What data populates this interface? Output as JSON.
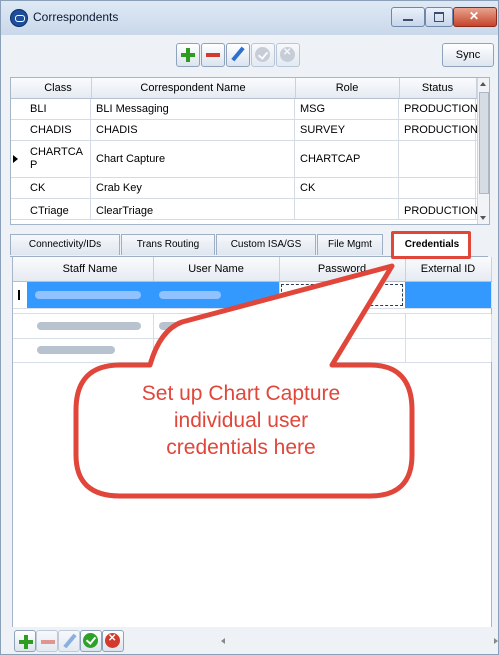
{
  "window": {
    "title": "Correspondents"
  },
  "toolbar": {
    "sync_label": "Sync"
  },
  "correspondents": {
    "columns": [
      "Class",
      "Correspondent Name",
      "Role",
      "Status"
    ],
    "rows": [
      {
        "class": "BLI",
        "name": "BLI Messaging",
        "role": "MSG",
        "status": "PRODUCTION"
      },
      {
        "class": "CHADIS",
        "name": "CHADIS",
        "role": "SURVEY",
        "status": "PRODUCTION"
      },
      {
        "class": "CHARTCA P",
        "name": "Chart Capture",
        "role": "CHARTCAP",
        "status": ""
      },
      {
        "class": "CK",
        "name": "Crab Key",
        "role": "CK",
        "status": ""
      },
      {
        "class": "CTriage",
        "name": "ClearTriage",
        "role": "",
        "status": "PRODUCTION"
      }
    ]
  },
  "tabs": [
    "Connectivity/IDs",
    "Trans Routing",
    "Custom ISA/GS",
    "File Mgmt",
    "Credentials"
  ],
  "active_tab": "Credentials",
  "credentials": {
    "columns": [
      "Staff Name",
      "User Name",
      "Password",
      "External ID"
    ]
  },
  "callout": {
    "lines": [
      "Set up Chart Capture",
      "individual user",
      "credentials here"
    ],
    "color": "#e0463a"
  }
}
